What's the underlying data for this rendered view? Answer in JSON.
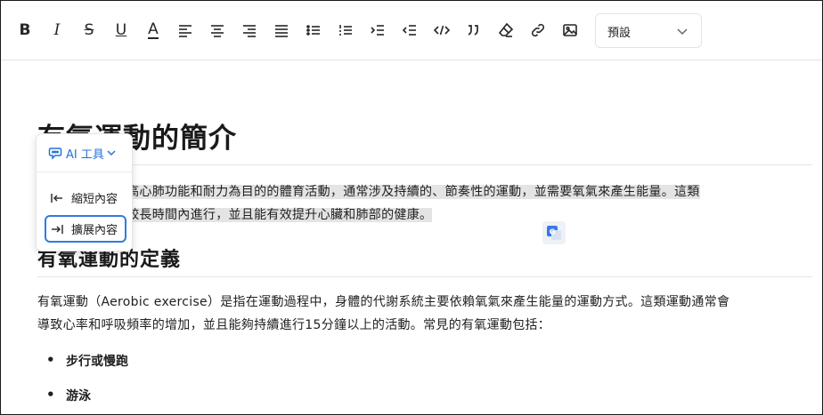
{
  "toolbar": {
    "bold": "B",
    "italic": "I",
    "strike": "S",
    "underline": "U",
    "text_color_letter": "A",
    "heading_select": {
      "value": "預設"
    }
  },
  "document": {
    "title": "有氧運動的簡介",
    "intro_lines": [
      "有氧運動是以提高心肺功能和耐力為目的的體育活動，通常涉及持續的、節奏性的運動，並需要氧氣來產生能量。這類",
      "運動通常能夠在較長時間內進行，並且能有效提升心臟和肺部的健康。"
    ],
    "section_heading": "有氧運動的定義",
    "definition_lines": [
      "有氧運動（Aerobic exercise）是指在運動過程中，身體的代謝系統主要依賴氧氣來產生能量的運動方式。這類運動通常會",
      "導致心率和呼吸頻率的增加，並且能夠持續進行15分鐘以上的活動。常見的有氧運動包括："
    ],
    "list_items": [
      "步行或慢跑",
      "游泳"
    ]
  },
  "ai_menu": {
    "title": "AI 工具",
    "items": [
      {
        "label": "縮短內容",
        "icon": "arrow-to-left-icon"
      },
      {
        "label": "擴展內容",
        "icon": "arrow-to-right-icon",
        "active": true
      }
    ]
  },
  "colors": {
    "accent": "#2f7be0",
    "highlight": "#e4e4e4"
  }
}
